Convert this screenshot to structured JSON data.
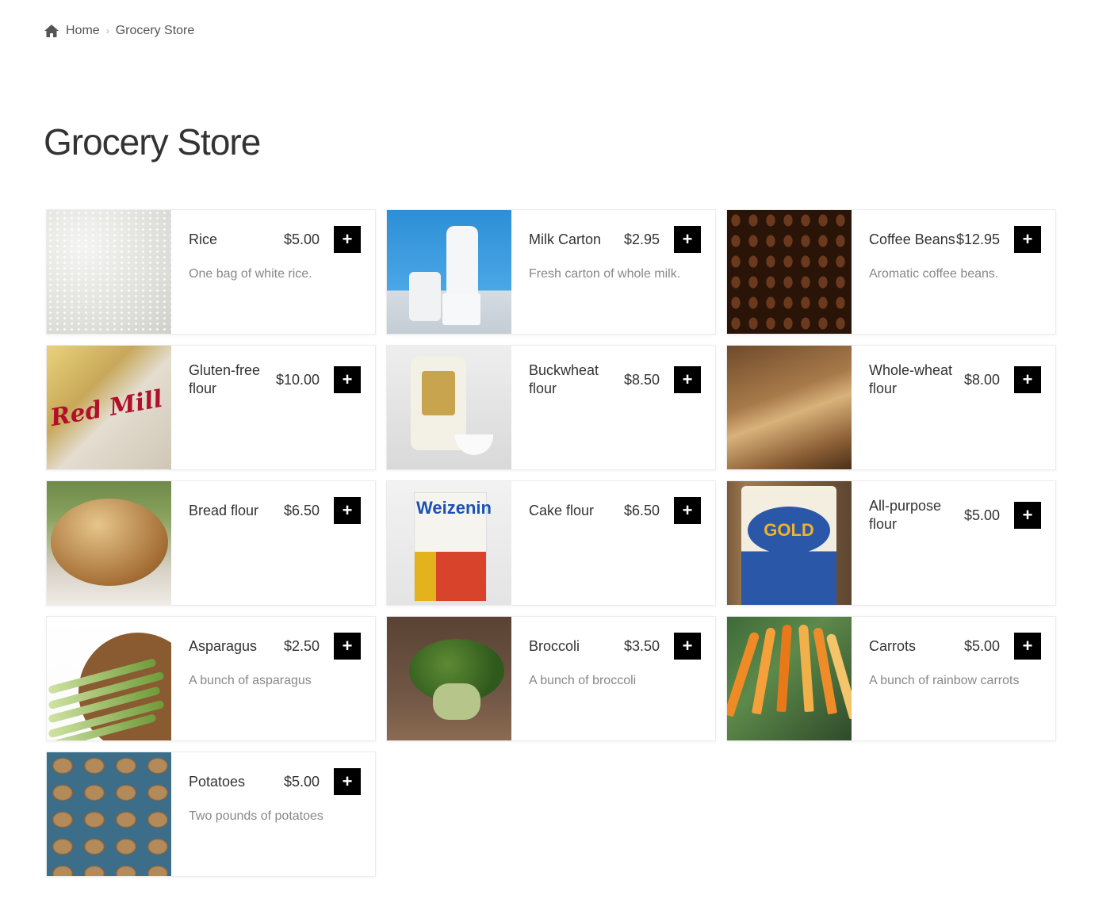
{
  "breadcrumb": {
    "home": "Home",
    "current": "Grocery Store"
  },
  "page": {
    "title": "Grocery Store"
  },
  "products": [
    {
      "name": "Rice",
      "price": "$5.00",
      "description": "One bag of white rice."
    },
    {
      "name": "Milk Carton",
      "price": "$2.95",
      "description": "Fresh carton of whole milk."
    },
    {
      "name": "Coffee Beans",
      "price": "$12.95",
      "description": "Aromatic coffee beans."
    },
    {
      "name": "Gluten-free flour",
      "price": "$10.00",
      "description": ""
    },
    {
      "name": "Buckwheat flour",
      "price": "$8.50",
      "description": ""
    },
    {
      "name": "Whole-wheat flour",
      "price": "$8.00",
      "description": ""
    },
    {
      "name": "Bread flour",
      "price": "$6.50",
      "description": ""
    },
    {
      "name": "Cake flour",
      "price": "$6.50",
      "description": ""
    },
    {
      "name": "All-purpose flour",
      "price": "$5.00",
      "description": ""
    },
    {
      "name": "Asparagus",
      "price": "$2.50",
      "description": "A bunch of asparagus"
    },
    {
      "name": "Broccoli",
      "price": "$3.50",
      "description": "A bunch of broccoli"
    },
    {
      "name": "Carrots",
      "price": "$5.00",
      "description": "A bunch of rainbow carrots"
    },
    {
      "name": "Potatoes",
      "price": "$5.00",
      "description": "Two pounds of potatoes"
    }
  ],
  "image_text": {
    "glutenfree_label": "Red Mill",
    "cake_brand": "Weizenin",
    "allpurpose_brand": "GOLD"
  },
  "add_label": "+",
  "icons": {
    "home": "home-icon",
    "separator": "chevron-right-icon",
    "add": "plus-icon"
  },
  "colors": {
    "add_button": "#000000",
    "text": "#333333",
    "muted": "#888888"
  }
}
